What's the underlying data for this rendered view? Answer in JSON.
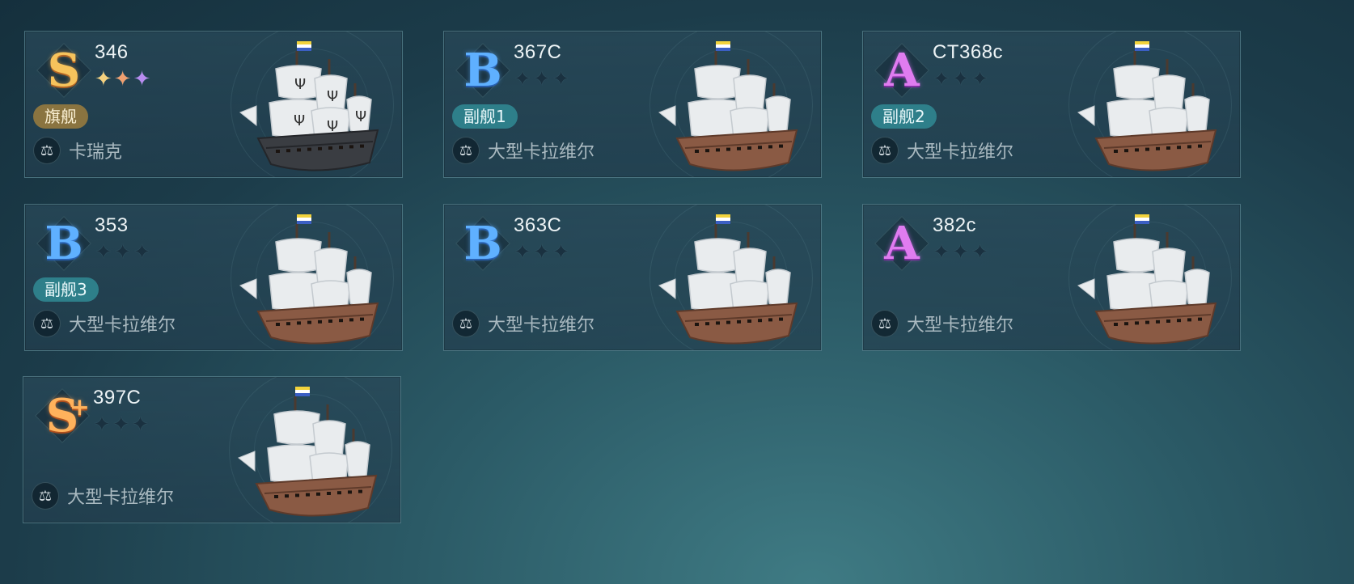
{
  "cards": [
    {
      "grade": "S",
      "code": "346",
      "stars": 3,
      "role": "旗舰",
      "type": "卡瑞克",
      "ship": "dark"
    },
    {
      "grade": "B",
      "code": "367C",
      "stars": 0,
      "role": "副舰1",
      "type": "大型卡拉维尔",
      "ship": "caravel"
    },
    {
      "grade": "A",
      "code": "CT368c",
      "stars": 0,
      "role": "副舰2",
      "type": "大型卡拉维尔",
      "ship": "caravel"
    },
    {
      "grade": "B",
      "code": "353",
      "stars": 0,
      "role": "副舰3",
      "type": "大型卡拉维尔",
      "ship": "caravel"
    },
    {
      "grade": "B",
      "code": "363C",
      "stars": 0,
      "role": "",
      "type": "大型卡拉维尔",
      "ship": "caravel"
    },
    {
      "grade": "A",
      "code": "382c",
      "stars": 0,
      "role": "",
      "type": "大型卡拉维尔",
      "ship": "caravel"
    },
    {
      "grade": "S+",
      "code": "397C",
      "stars": 0,
      "role": "",
      "type": "大型卡拉维尔",
      "ship": "caravel"
    }
  ],
  "icons": {
    "type_icon": "scales-icon",
    "star_icon": "four-point-star-icon"
  },
  "colors": {
    "grade_S": "#f6c35c",
    "grade_A": "#e07cf0",
    "grade_B": "#5fb0ff",
    "role_flagship": "#8a7440",
    "role_sub": "#2e7f8a"
  }
}
